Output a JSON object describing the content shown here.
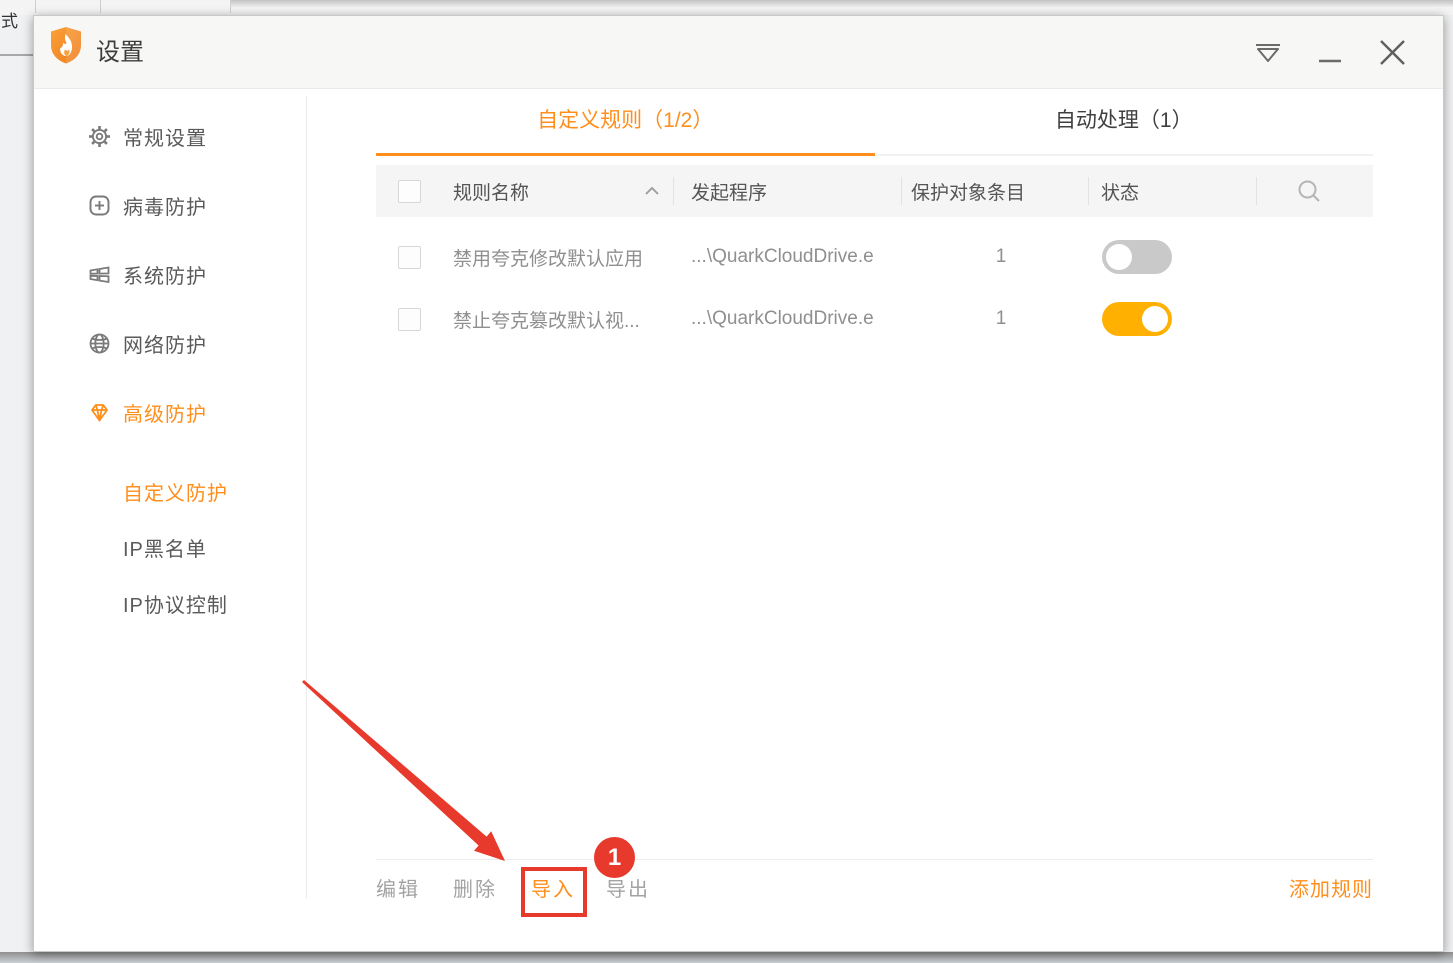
{
  "desktop": {
    "corner_char": "式"
  },
  "titlebar": {
    "title": "设置",
    "controls": [
      "menu-icon",
      "minimize-icon",
      "close-icon"
    ]
  },
  "sidebar": {
    "items": [
      {
        "label": "常规设置",
        "icon": "gear-icon",
        "active": false
      },
      {
        "label": "病毒防护",
        "icon": "plus-square-icon",
        "active": false
      },
      {
        "label": "系统防护",
        "icon": "window-panes-icon",
        "active": false
      },
      {
        "label": "网络防护",
        "icon": "globe-icon",
        "active": false
      },
      {
        "label": "高级防护",
        "icon": "diamond-icon",
        "active": true
      }
    ],
    "subitems": [
      {
        "label": "自定义防护",
        "active": true
      },
      {
        "label": "IP黑名单",
        "active": false
      },
      {
        "label": "IP协议控制",
        "active": false
      }
    ]
  },
  "tabs": [
    {
      "label": "自定义规则（1/2）",
      "active": true
    },
    {
      "label": "自动处理（1）",
      "active": false
    }
  ],
  "table": {
    "header": {
      "name": "规则名称",
      "program": "发起程序",
      "entries": "保护对象条目",
      "status": "状态",
      "sort_icon": "sort-asc-icon",
      "search_icon": "search-icon"
    },
    "rows": [
      {
        "name": "禁用夸克修改默认应用",
        "program": "...\\QuarkCloudDrive.e",
        "entries": "1",
        "enabled": false
      },
      {
        "name": "禁止夸克篡改默认视...",
        "program": "...\\QuarkCloudDrive.e",
        "entries": "1",
        "enabled": true
      }
    ]
  },
  "footer": {
    "edit": "编辑",
    "delete": "删除",
    "import": "导入",
    "export": "导出",
    "add_rule": "添加规则"
  },
  "annotation": {
    "step_badge": "1"
  },
  "colors": {
    "accent_orange": "#ff8e1c",
    "toggle_on": "#ffb000",
    "toggle_off": "#c9c9c9",
    "annotation_red": "#e8392d",
    "titlebar_bg": "#f7f7f5",
    "table_header_bg": "#f5f5f5"
  }
}
